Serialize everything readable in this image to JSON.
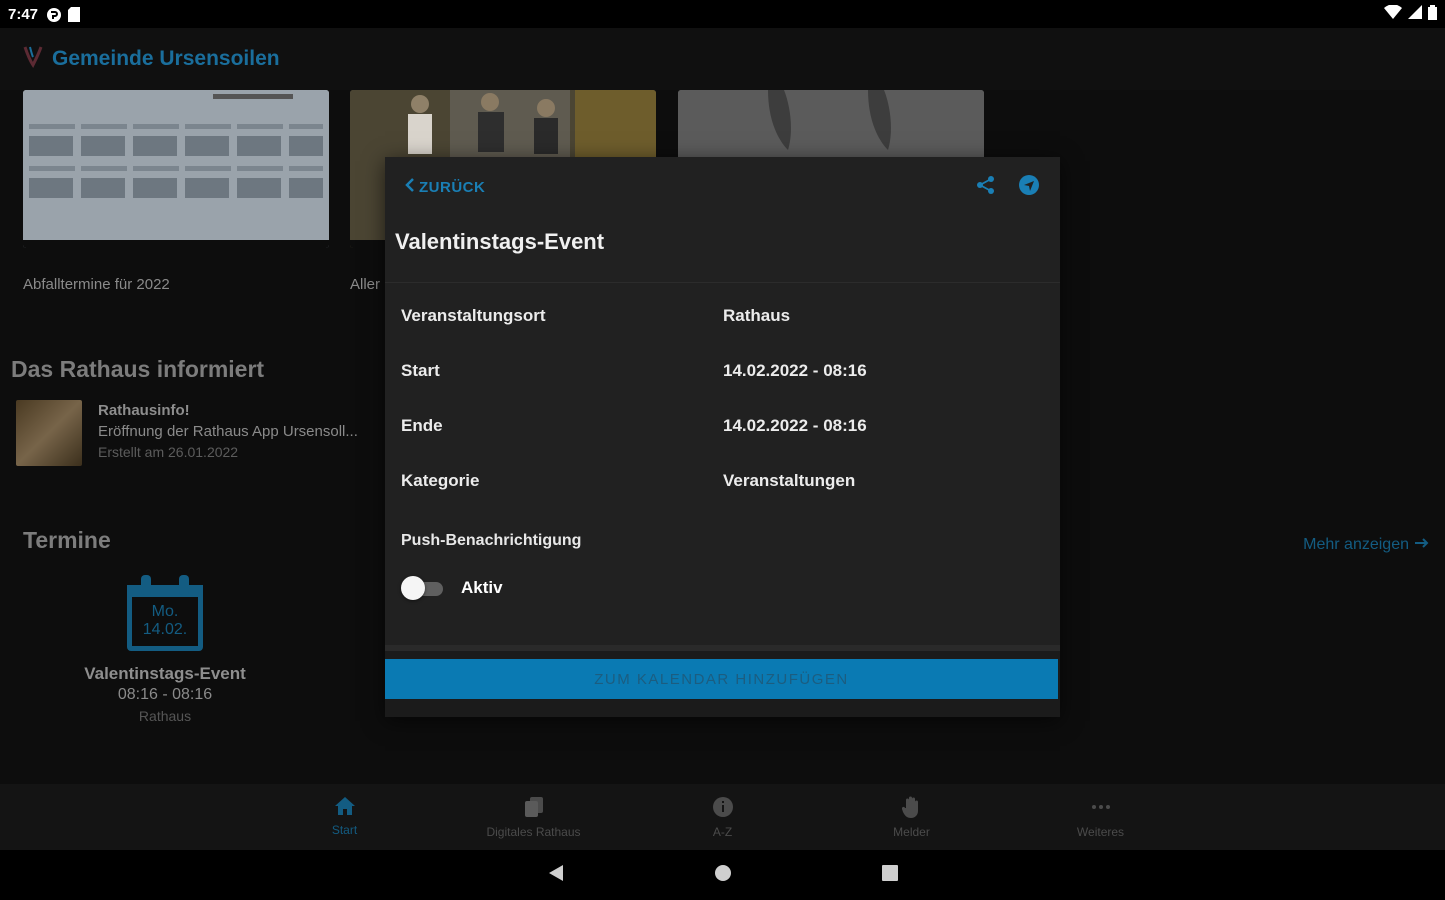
{
  "status_bar": {
    "time": "7:47"
  },
  "app_bar": {
    "title": "Gemeinde Ursensoilen"
  },
  "cards": [
    {
      "caption": "Abfalltermine für 2022"
    },
    {
      "caption": "Aller"
    },
    {
      "caption": ""
    }
  ],
  "news_section": {
    "title": "Das Rathaus informiert",
    "item": {
      "title": "Rathausinfo!",
      "subtitle": "Eröffnung der Rathaus App Ursensoll...",
      "date": "Erstellt am 26.01.2022"
    }
  },
  "events_section": {
    "title": "Termine",
    "more_label": "Mehr anzeigen",
    "event": {
      "cal_day": "Mo.",
      "cal_date": "14.02.",
      "name": "Valentinstags-Event",
      "time": "08:16 - 08:16",
      "place": "Rathaus"
    }
  },
  "dialog": {
    "back_label": "ZURÜCK",
    "title": "Valentinstags-Event",
    "rows": [
      {
        "key": "Veranstaltungsort",
        "value": "Rathaus"
      },
      {
        "key": "Start",
        "value": "14.02.2022 - 08:16"
      },
      {
        "key": "Ende",
        "value": "14.02.2022 - 08:16"
      },
      {
        "key": "Kategorie",
        "value": "Veranstaltungen"
      }
    ],
    "push_label": "Push-Benachrichtigung",
    "toggle_label": "Aktiv",
    "toggle_on": false,
    "calendar_button": "ZUM KALENDAR HINZUFÜGEN"
  },
  "bottom_nav": [
    {
      "label": "Start",
      "icon": "home-icon",
      "active": true
    },
    {
      "label": "Digitales Rathaus",
      "icon": "documents-icon",
      "active": false
    },
    {
      "label": "A-Z",
      "icon": "info-icon",
      "active": false
    },
    {
      "label": "Melder",
      "icon": "hand-icon",
      "active": false
    },
    {
      "label": "Weiteres",
      "icon": "more-icon",
      "active": false
    }
  ],
  "colors": {
    "accent": "#0a7ab3",
    "accent_dim": "#135c82",
    "dialog_bg": "#212121"
  }
}
